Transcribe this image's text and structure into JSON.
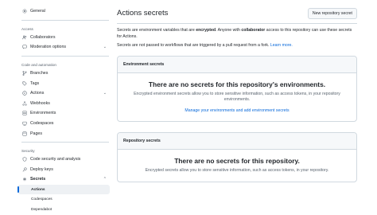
{
  "sidebar": {
    "general": "General",
    "access_section": "Access",
    "collaborators": "Collaborators",
    "moderation": "Moderation options",
    "code_section": "Code and automation",
    "branches": "Branches",
    "tags": "Tags",
    "actions": "Actions",
    "webhooks": "Webhooks",
    "environments": "Environments",
    "codespaces": "Codespaces",
    "pages": "Pages",
    "security_section": "Security",
    "code_security": "Code security and analysis",
    "deploy_keys": "Deploy keys",
    "secrets": "Secrets",
    "sub": {
      "actions": "Actions",
      "codespaces": "Codespaces",
      "dependabot": "Dependabot"
    }
  },
  "main": {
    "title": "Actions secrets",
    "new_button": "New repository secret",
    "desc_1": "Secrets are environment variables that are ",
    "desc_bold_1": "encrypted",
    "desc_2": ". Anyone with ",
    "desc_bold_2": "collaborator",
    "desc_3": " access to this repository can use these secrets for Actions.",
    "note": "Secrets are not passed to workflows that are triggered by a pull request from a fork. ",
    "learn_more": "Learn more."
  },
  "env_box": {
    "header": "Environment secrets",
    "title": "There are no secrets for this repository's environments.",
    "desc": "Encrypted environment secrets allow you to store sensitive information, such as access tokens, in your repository environments.",
    "link": "Manage your environments and add environment secrets"
  },
  "repo_box": {
    "header": "Repository secrets",
    "title": "There are no secrets for this repository.",
    "desc": "Encrypted secrets allow you to store sensitive information, such as access tokens, in your repository."
  },
  "icons": {
    "general": "gear-icon",
    "collaborators": "people-icon",
    "moderation": "report-icon",
    "branches": "branch-icon",
    "tags": "tag-icon",
    "actions": "play-icon",
    "webhooks": "webhook-icon",
    "environments": "server-icon",
    "codespaces": "codespaces-icon",
    "pages": "browser-icon",
    "code_security": "shield-icon",
    "deploy_keys": "key-icon",
    "secrets": "asterisk-icon"
  },
  "colors": {
    "accent": "#0969da",
    "border": "#d1d9e0",
    "muted_text": "#59636e"
  }
}
